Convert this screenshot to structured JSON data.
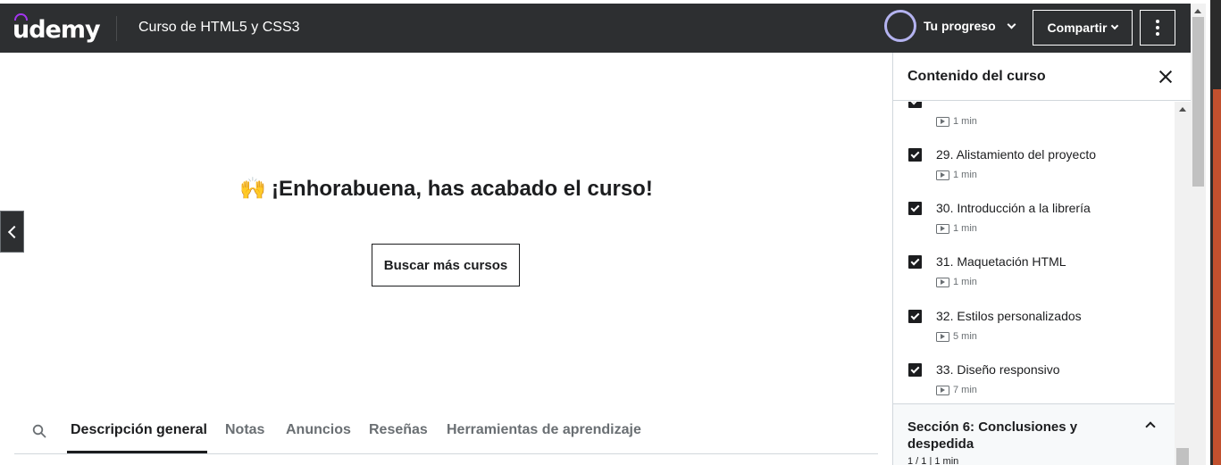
{
  "header": {
    "logo_text": "udemy",
    "course_title": "Curso de HTML5 y CSS3",
    "progress_label": "Tu progreso",
    "share_label": "Compartir",
    "accent_color": "#a435f0"
  },
  "main": {
    "congrats_emoji": "🙌",
    "congrats_text": "¡Enhorabuena, has acabado el curso!",
    "search_courses_label": "Buscar más cursos",
    "tabs": [
      {
        "label": "Descripción general",
        "active": true
      },
      {
        "label": "Notas",
        "active": false
      },
      {
        "label": "Anuncios",
        "active": false
      },
      {
        "label": "Reseñas",
        "active": false
      },
      {
        "label": "Herramientas de aprendizaje",
        "active": false
      }
    ]
  },
  "sidebar": {
    "title": "Contenido del curso",
    "partial_item_duration": "1 min",
    "lectures": [
      {
        "title": "29. Alistamiento del proyecto",
        "duration": "1 min",
        "completed": true
      },
      {
        "title": "30. Introducción a la librería",
        "duration": "1 min",
        "completed": true
      },
      {
        "title": "31. Maquetación HTML",
        "duration": "1 min",
        "completed": true
      },
      {
        "title": "32. Estilos personalizados",
        "duration": "5 min",
        "completed": true
      },
      {
        "title": "33. Diseño responsivo",
        "duration": "7 min",
        "completed": true
      }
    ],
    "next_section": {
      "title": "Sección 6: Conclusiones y despedida",
      "meta": "1 / 1 | 1 min"
    }
  }
}
